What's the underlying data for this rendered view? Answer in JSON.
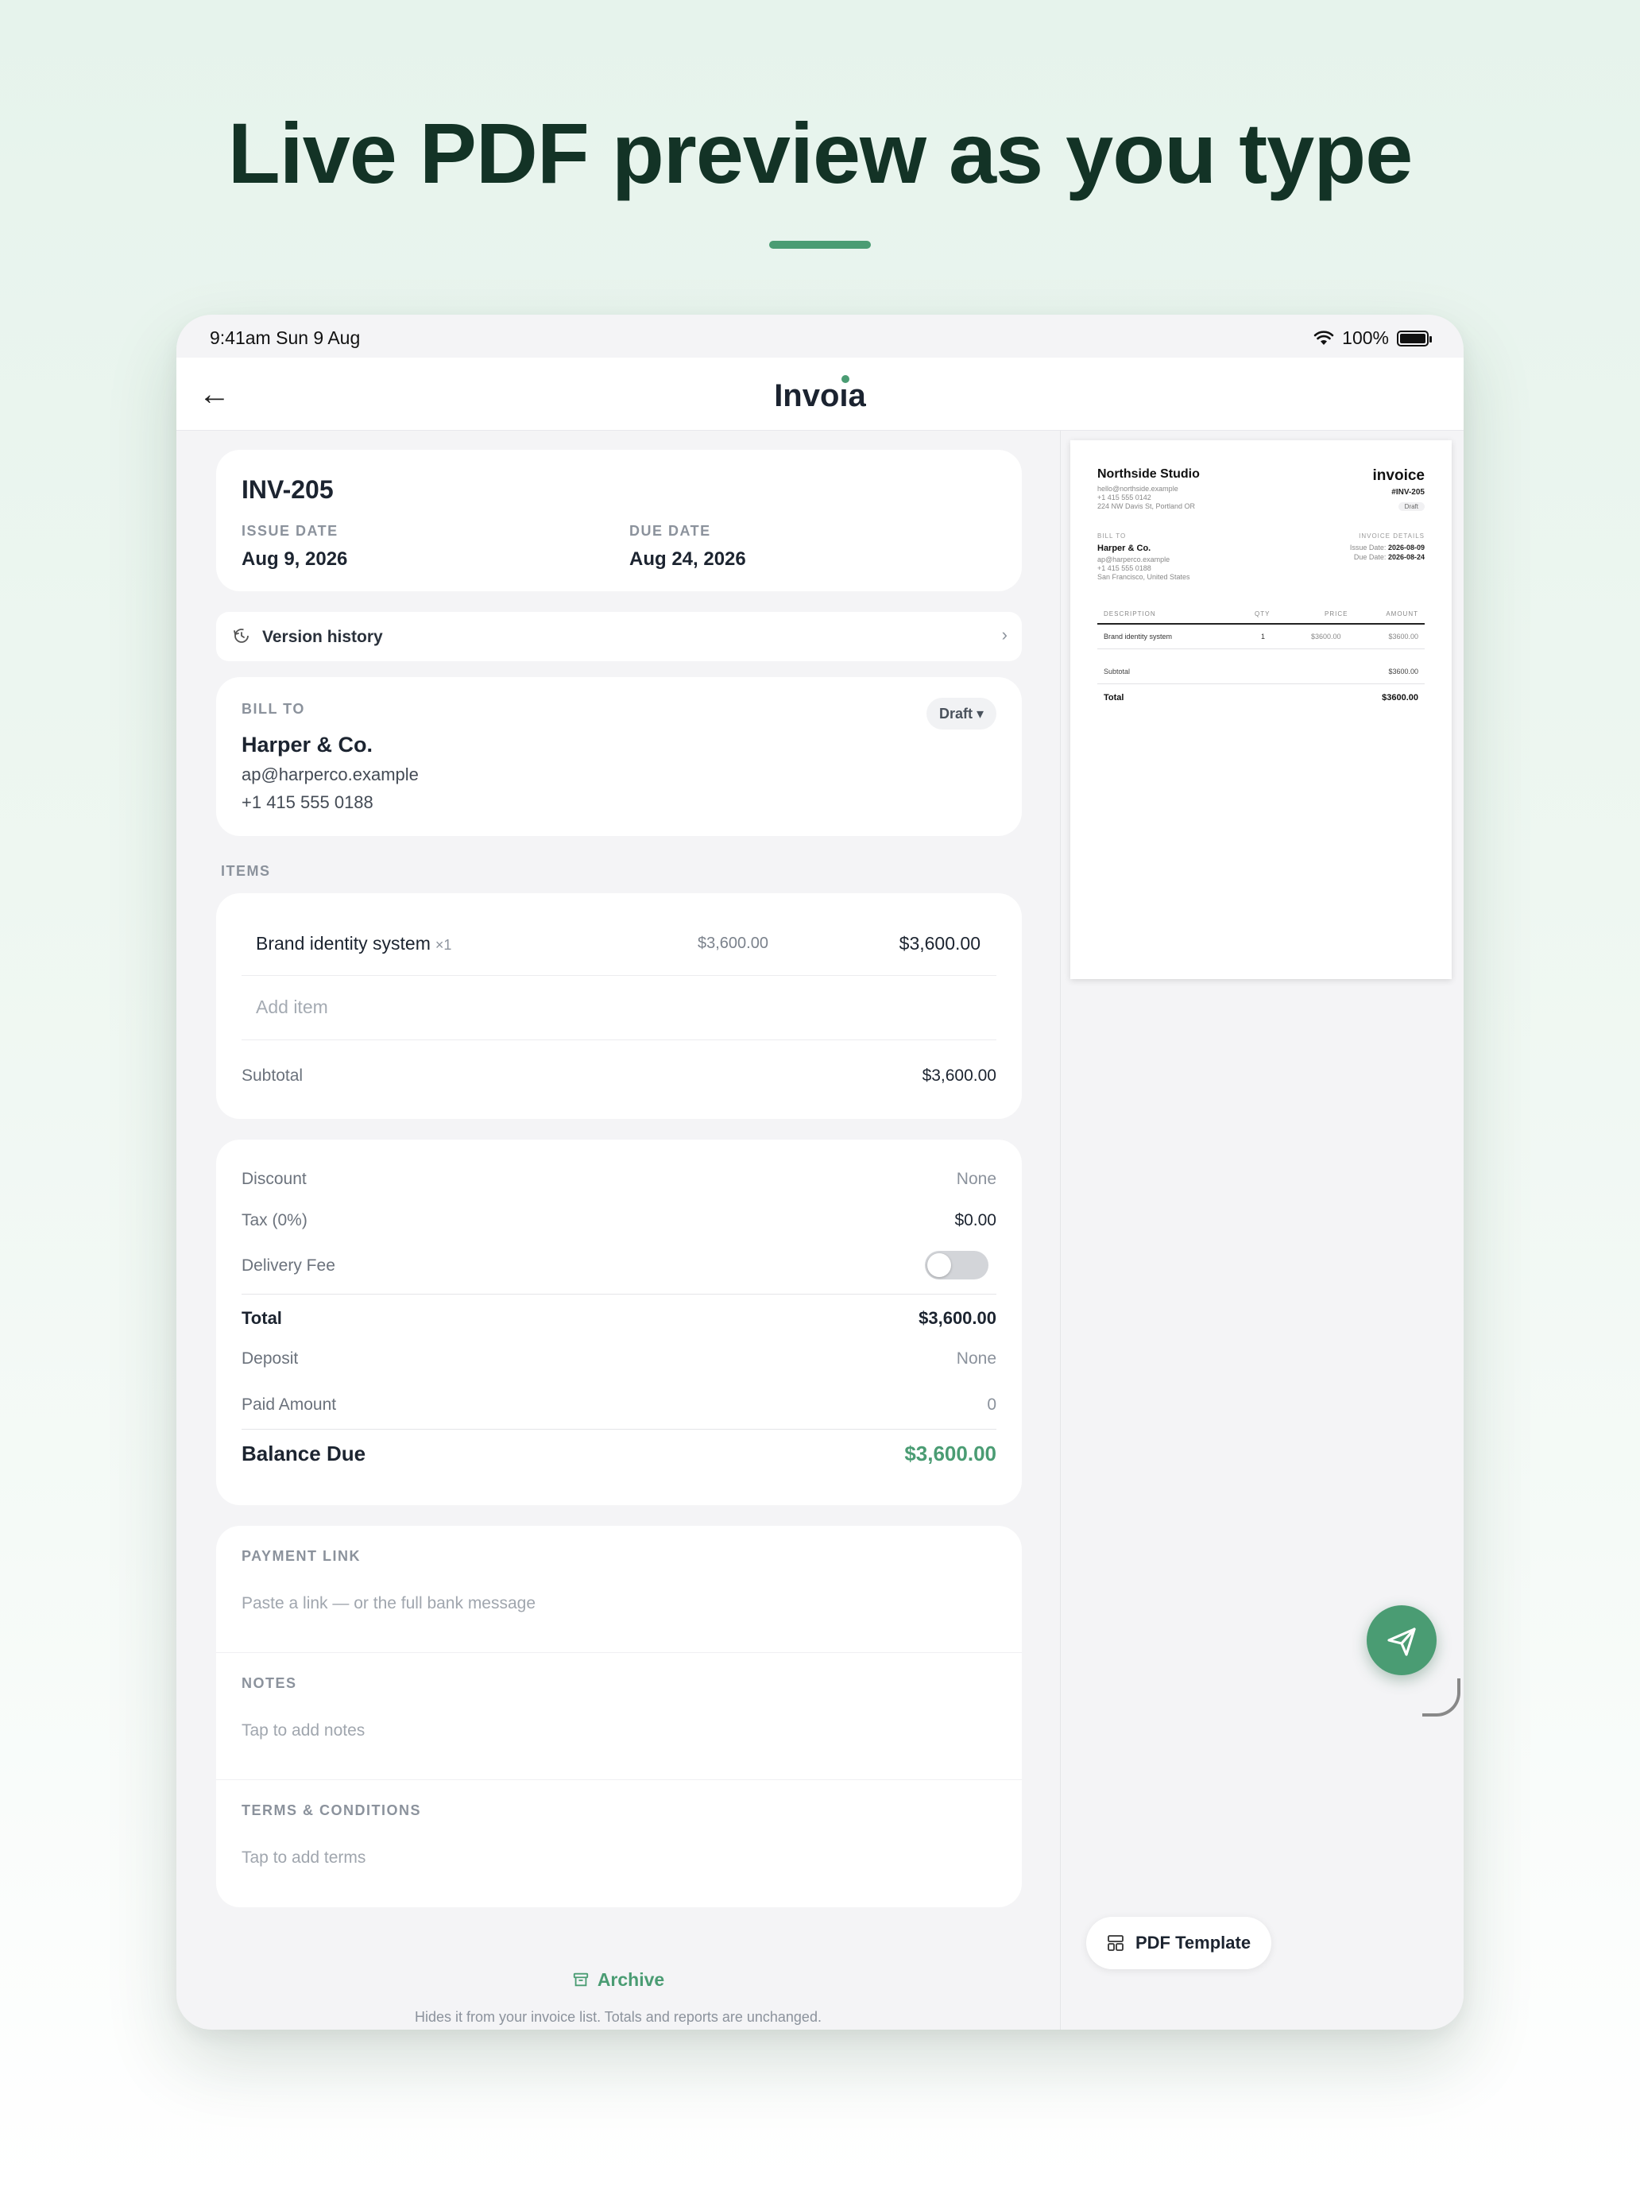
{
  "headline": "Live PDF preview as you type",
  "status": {
    "time": "9:41am  Sun 9 Aug",
    "battery": "100%"
  },
  "nav": {
    "back": "←",
    "logo": "Invoia"
  },
  "invoice": {
    "number": "INV-205",
    "issue_label": "ISSUE DATE",
    "issue_date": "Aug 9, 2026",
    "due_label": "DUE DATE",
    "due_date": "Aug 24, 2026"
  },
  "version_history": {
    "label": "Version history",
    "chevron": "›"
  },
  "bill_to": {
    "label": "BILL TO",
    "name": "Harper & Co.",
    "email": "ap@harperco.example",
    "phone": "+1 415 555 0188",
    "status": "Draft ▾"
  },
  "items": {
    "label": "ITEMS",
    "rows": [
      {
        "name": "Brand identity system",
        "qty": "×1",
        "price": "$3,600.00",
        "amount": "$3,600.00"
      }
    ],
    "add_placeholder": "Add item",
    "subtotal_label": "Subtotal",
    "subtotal": "$3,600.00"
  },
  "totals": {
    "discount_label": "Discount",
    "discount": "None",
    "tax_label": "Tax (0%)",
    "tax": "$0.00",
    "delivery_label": "Delivery Fee",
    "delivery_enabled": false,
    "total_label": "Total",
    "total": "$3,600.00",
    "deposit_label": "Deposit",
    "deposit": "None",
    "paid_label": "Paid Amount",
    "paid": "0",
    "balance_label": "Balance Due",
    "balance": "$3,600.00"
  },
  "extras": {
    "payment_label": "PAYMENT LINK",
    "payment_placeholder": "Paste a link — or the full bank message",
    "notes_label": "NOTES",
    "notes_placeholder": "Tap to add notes",
    "terms_label": "TERMS & CONDITIONS",
    "terms_placeholder": "Tap to add terms"
  },
  "archive": {
    "label": "Archive",
    "note": "Hides it from your invoice list. Totals and reports are unchanged."
  },
  "pdf": {
    "company": "Northside Studio",
    "company_email": "hello@northside.example",
    "company_phone": "+1 415 555 0142",
    "company_address": "224 NW Davis St, Portland OR",
    "title": "invoice",
    "number": "#INV-205",
    "status": "Draft",
    "bill_to_label": "BILL TO",
    "client": "Harper & Co.",
    "client_email": "ap@harperco.example",
    "client_phone": "+1 415 555 0188",
    "client_city": "San Francisco, United States",
    "details_label": "INVOICE DETAILS",
    "issue_label": "Issue Date:",
    "issue": "2026-08-09",
    "due_label": "Due Date:",
    "due": "2026-08-24",
    "col_desc": "DESCRIPTION",
    "col_qty": "QTY",
    "col_price": "PRICE",
    "col_amount": "AMOUNT",
    "row_desc": "Brand identity system",
    "row_qty": "1",
    "row_price": "$3600.00",
    "row_amount": "$3600.00",
    "subtotal_label": "Subtotal",
    "subtotal": "$3600.00",
    "total_label": "Total",
    "total": "$3600.00"
  },
  "pdf_template_label": "PDF Template",
  "colors": {
    "accent": "#4a9c73",
    "headline": "#133326",
    "background": "#f4f4f6"
  }
}
